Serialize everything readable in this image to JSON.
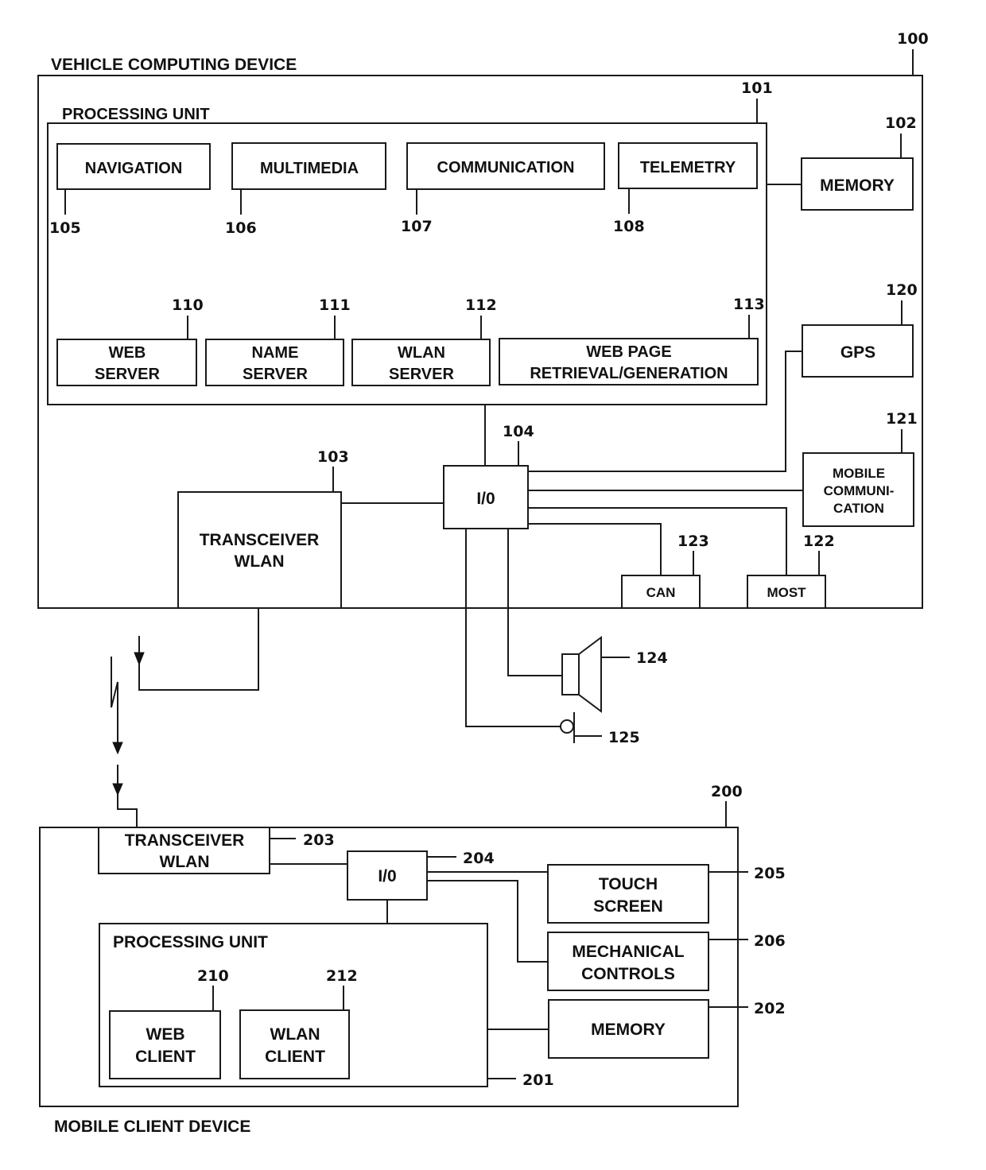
{
  "vehicle": {
    "title": "VEHICLE COMPUTING DEVICE",
    "ref": "100",
    "processing_unit": {
      "title": "PROCESSING UNIT",
      "ref": "101",
      "modules": [
        {
          "lines": [
            "NAVIGATION"
          ],
          "ref": "105"
        },
        {
          "lines": [
            "MULTIMEDIA"
          ],
          "ref": "106"
        },
        {
          "lines": [
            "COMMUNICATION"
          ],
          "ref": "107"
        },
        {
          "lines": [
            "TELEMETRY"
          ],
          "ref": "108"
        },
        {
          "lines": [
            "WEB",
            "SERVER"
          ],
          "ref": "110"
        },
        {
          "lines": [
            "NAME",
            "SERVER"
          ],
          "ref": "111"
        },
        {
          "lines": [
            "WLAN",
            "SERVER"
          ],
          "ref": "112"
        },
        {
          "lines": [
            "WEB PAGE",
            "RETRIEVAL/GENERATION"
          ],
          "ref": "113"
        }
      ]
    },
    "memory": {
      "label": "MEMORY",
      "ref": "102"
    },
    "transceiver": {
      "lines": [
        "TRANSCEIVER",
        "WLAN"
      ],
      "ref": "103"
    },
    "io": {
      "label": "I/0",
      "ref": "104"
    },
    "gps": {
      "label": "GPS",
      "ref": "120"
    },
    "mobile_comm": {
      "lines": [
        "MOBILE",
        "COMMUNI-",
        "CATION"
      ],
      "ref": "121"
    },
    "most": {
      "label": "MOST",
      "ref": "122"
    },
    "can": {
      "label": "CAN",
      "ref": "123"
    },
    "speaker": {
      "icon": "speaker-icon",
      "ref": "124"
    },
    "microphone": {
      "icon": "microphone-icon",
      "ref": "125"
    }
  },
  "mobile": {
    "title": "MOBILE CLIENT DEVICE",
    "ref": "200",
    "transceiver": {
      "lines": [
        "TRANSCEIVER",
        "WLAN"
      ],
      "ref": "203"
    },
    "io": {
      "label": "I/0",
      "ref": "204"
    },
    "touch_screen": {
      "lines": [
        "TOUCH",
        "SCREEN"
      ],
      "ref": "205"
    },
    "mechanical_controls": {
      "lines": [
        "MECHANICAL",
        "CONTROLS"
      ],
      "ref": "206"
    },
    "memory": {
      "label": "MEMORY",
      "ref": "202"
    },
    "processing_unit": {
      "title": "PROCESSING UNIT",
      "ref": "201",
      "web_client": {
        "lines": [
          "WEB",
          "CLIENT"
        ],
        "ref": "210"
      },
      "wlan_client": {
        "lines": [
          "WLAN",
          "CLIENT"
        ],
        "ref": "212"
      }
    }
  },
  "wireless_link": {
    "icon": "wireless-signal-icon"
  }
}
